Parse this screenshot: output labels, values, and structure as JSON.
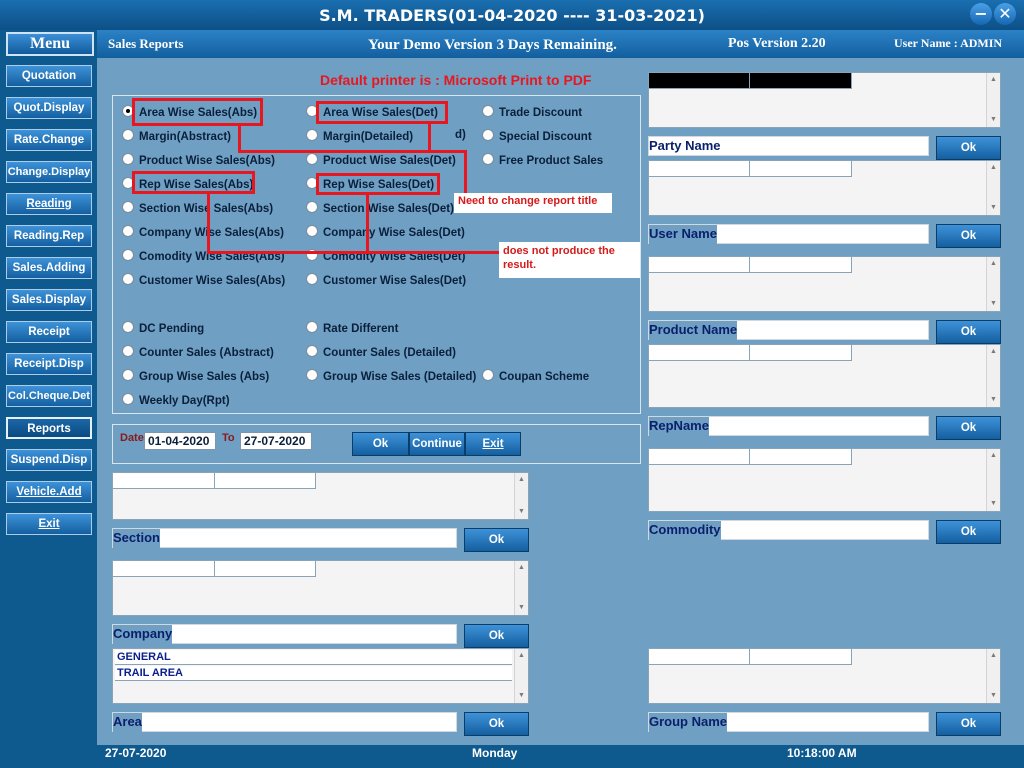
{
  "window": {
    "title": "S.M. TRADERS(01-04-2020 ---- 31-03-2021)",
    "minimize_icon": "−",
    "close_icon": "✕"
  },
  "header": {
    "section": "Sales Reports",
    "demo_notice": "Your Demo Version 3 Days Remaining.",
    "version": "Pos Version 2.20",
    "user": "User Name : ADMIN"
  },
  "menu": {
    "title": "Menu",
    "items": [
      "Quotation",
      "Quot.Display",
      "Rate.Change",
      "Change.Display",
      "Reading",
      "Reading.Rep",
      "Sales.Adding",
      "Sales.Display",
      "Receipt",
      "Receipt.Disp",
      "Col.Cheque.Det",
      "Reports",
      "Suspend.Disp",
      "Vehicle.Add",
      "Exit"
    ]
  },
  "printer": "Default printer is : Microsoft Print to PDF",
  "reports": {
    "col1": [
      "Area Wise Sales(Abs)",
      "Margin(Abstract)",
      "Product Wise Sales(Abs)",
      "Rep Wise Sales(Abs)",
      "Section Wise Sales(Abs)",
      "Company Wise Sales(Abs)",
      "Comodity Wise Sales(Abs)",
      "Customer Wise Sales(Abs)",
      "DC Pending",
      "Counter Sales (Abstract)",
      "Group Wise Sales (Abs)",
      "Weekly Day(Rpt)"
    ],
    "col2": [
      "Area Wise Sales(Det)",
      "Margin(Detailed)",
      "Product Wise Sales(Det)",
      "Rep Wise Sales(Det)",
      "Section Wise Sales(Det)",
      "Company Wise Sales(Det)",
      "Comodity Wise Sales(Det)",
      "Customer Wise Sales(Det)",
      "Rate Different",
      "Counter Sales (Detailed)",
      "Group Wise Sales (Detailed)"
    ],
    "col3": [
      "Trade Discount",
      "Special Discount",
      "Free Product Sales",
      "Coupan Scheme"
    ],
    "col2_fragment": "d)"
  },
  "annotations": {
    "note1": "Need to change report title",
    "note2": "does not produce the result."
  },
  "date": {
    "label": "Date",
    "from": "01-04-2020",
    "to_label": "To",
    "to": "27-07-2020"
  },
  "buttons": {
    "ok": "Ok",
    "continue": "Continue",
    "exit": "Exit"
  },
  "left_panels": {
    "section": "Section",
    "company": "Company",
    "area": "Area",
    "area_items": [
      "GENERAL",
      "TRAIL AREA"
    ]
  },
  "right_panels": {
    "party": "Party Name",
    "user": "User Name",
    "product": "Product Name",
    "rep": "RepName",
    "commodity": "Commodity",
    "group": "Group Name"
  },
  "status": {
    "date": "27-07-2020",
    "day": "Monday",
    "time": "10:18:00 AM"
  }
}
